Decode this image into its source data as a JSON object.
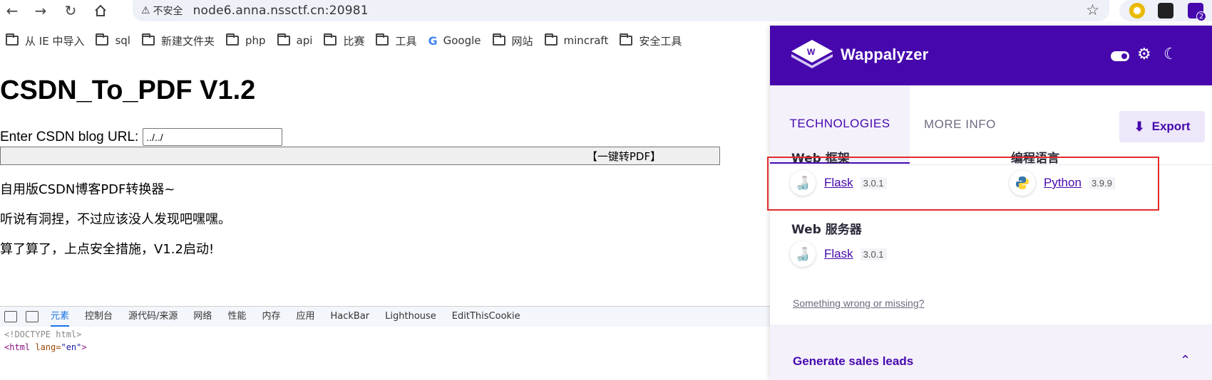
{
  "browser": {
    "security_label": "不安全",
    "url": "node6.anna.nssctf.cn:20981",
    "ext_badge": "2"
  },
  "bookmarks": [
    {
      "label": "从 IE 中导入",
      "icon": "folder-icon"
    },
    {
      "label": "sql",
      "icon": "folder-icon"
    },
    {
      "label": "新建文件夹",
      "icon": "folder-icon"
    },
    {
      "label": "php",
      "icon": "folder-icon"
    },
    {
      "label": "api",
      "icon": "folder-icon"
    },
    {
      "label": "比赛",
      "icon": "folder-icon"
    },
    {
      "label": "工具",
      "icon": "folder-icon"
    },
    {
      "label": "Google",
      "icon": "google-icon"
    },
    {
      "label": "网站",
      "icon": "folder-icon"
    },
    {
      "label": "mincraft",
      "icon": "folder-icon"
    },
    {
      "label": "安全工具",
      "icon": "folder-icon"
    }
  ],
  "page": {
    "title": "CSDN_To_PDF V1.2",
    "url_label": "Enter CSDN blog URL:",
    "url_value": "../../",
    "convert_button": "【一键转PDF】",
    "lines": [
      "自用版CSDN博客PDF转换器~",
      "听说有洞捏，不过应该没人发现吧嘿嘿。",
      "算了算了，上点安全措施，V1.2启动!"
    ]
  },
  "devtools": {
    "tabs": [
      "元素",
      "控制台",
      "源代码/来源",
      "网络",
      "性能",
      "内存",
      "应用",
      "HackBar",
      "Lighthouse",
      "EditThisCookie"
    ],
    "active_tab": "元素",
    "code_line1": "<!DOCTYPE html>",
    "code_tag": "<html",
    "code_attr": " lang=",
    "code_val": "\"en\"",
    "code_end": ">"
  },
  "wappalyzer": {
    "brand": "Wappalyzer",
    "tab_technologies": "TECHNOLOGIES",
    "tab_more_info": "MORE INFO",
    "export_label": "Export",
    "categories": [
      {
        "name": "Web 框架",
        "tech": "Flask",
        "version": "3.0.1"
      },
      {
        "name": "编程语言",
        "tech": "Python",
        "version": "3.9.9"
      },
      {
        "name": "Web 服务器",
        "tech": "Flask",
        "version": "3.0.1"
      }
    ],
    "feedback_link": "Something wrong or missing?",
    "leads_title": "Generate sales leads"
  },
  "colors": {
    "wappalyzer_purple": "#4608ad",
    "highlight_red": "#e32b2b"
  }
}
